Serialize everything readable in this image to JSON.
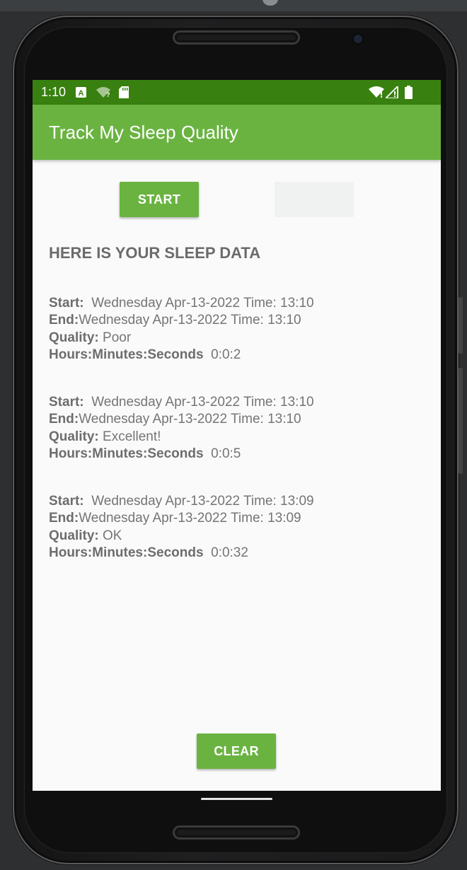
{
  "status_bar": {
    "time": "1:10",
    "left_icons": [
      "a-notification-icon",
      "wifi-question-icon",
      "sd-card-icon"
    ],
    "right_icons": [
      "wifi-icon",
      "signal-icon",
      "battery-icon"
    ],
    "background": "#38800f"
  },
  "app_bar": {
    "title": "Track My Sleep Quality",
    "background": "#6ab341"
  },
  "buttons": {
    "start_label": "START",
    "stop_label": "",
    "clear_label": "CLEAR"
  },
  "heading": "HERE IS YOUR SLEEP DATA",
  "labels": {
    "start": "Start:",
    "end": "End:",
    "quality": "Quality:",
    "duration": "Hours:Minutes:Seconds"
  },
  "records": [
    {
      "start": "Wednesday Apr-13-2022 Time: 13:10",
      "end": "Wednesday Apr-13-2022 Time: 13:10",
      "quality": "Poor",
      "duration": "0:0:2"
    },
    {
      "start": "Wednesday Apr-13-2022 Time: 13:10",
      "end": "Wednesday Apr-13-2022 Time: 13:10",
      "quality": "Excellent!",
      "duration": "0:0:5"
    },
    {
      "start": "Wednesday Apr-13-2022 Time: 13:09",
      "end": "Wednesday Apr-13-2022 Time: 13:09",
      "quality": "OK",
      "duration": "0:0:32"
    }
  ]
}
